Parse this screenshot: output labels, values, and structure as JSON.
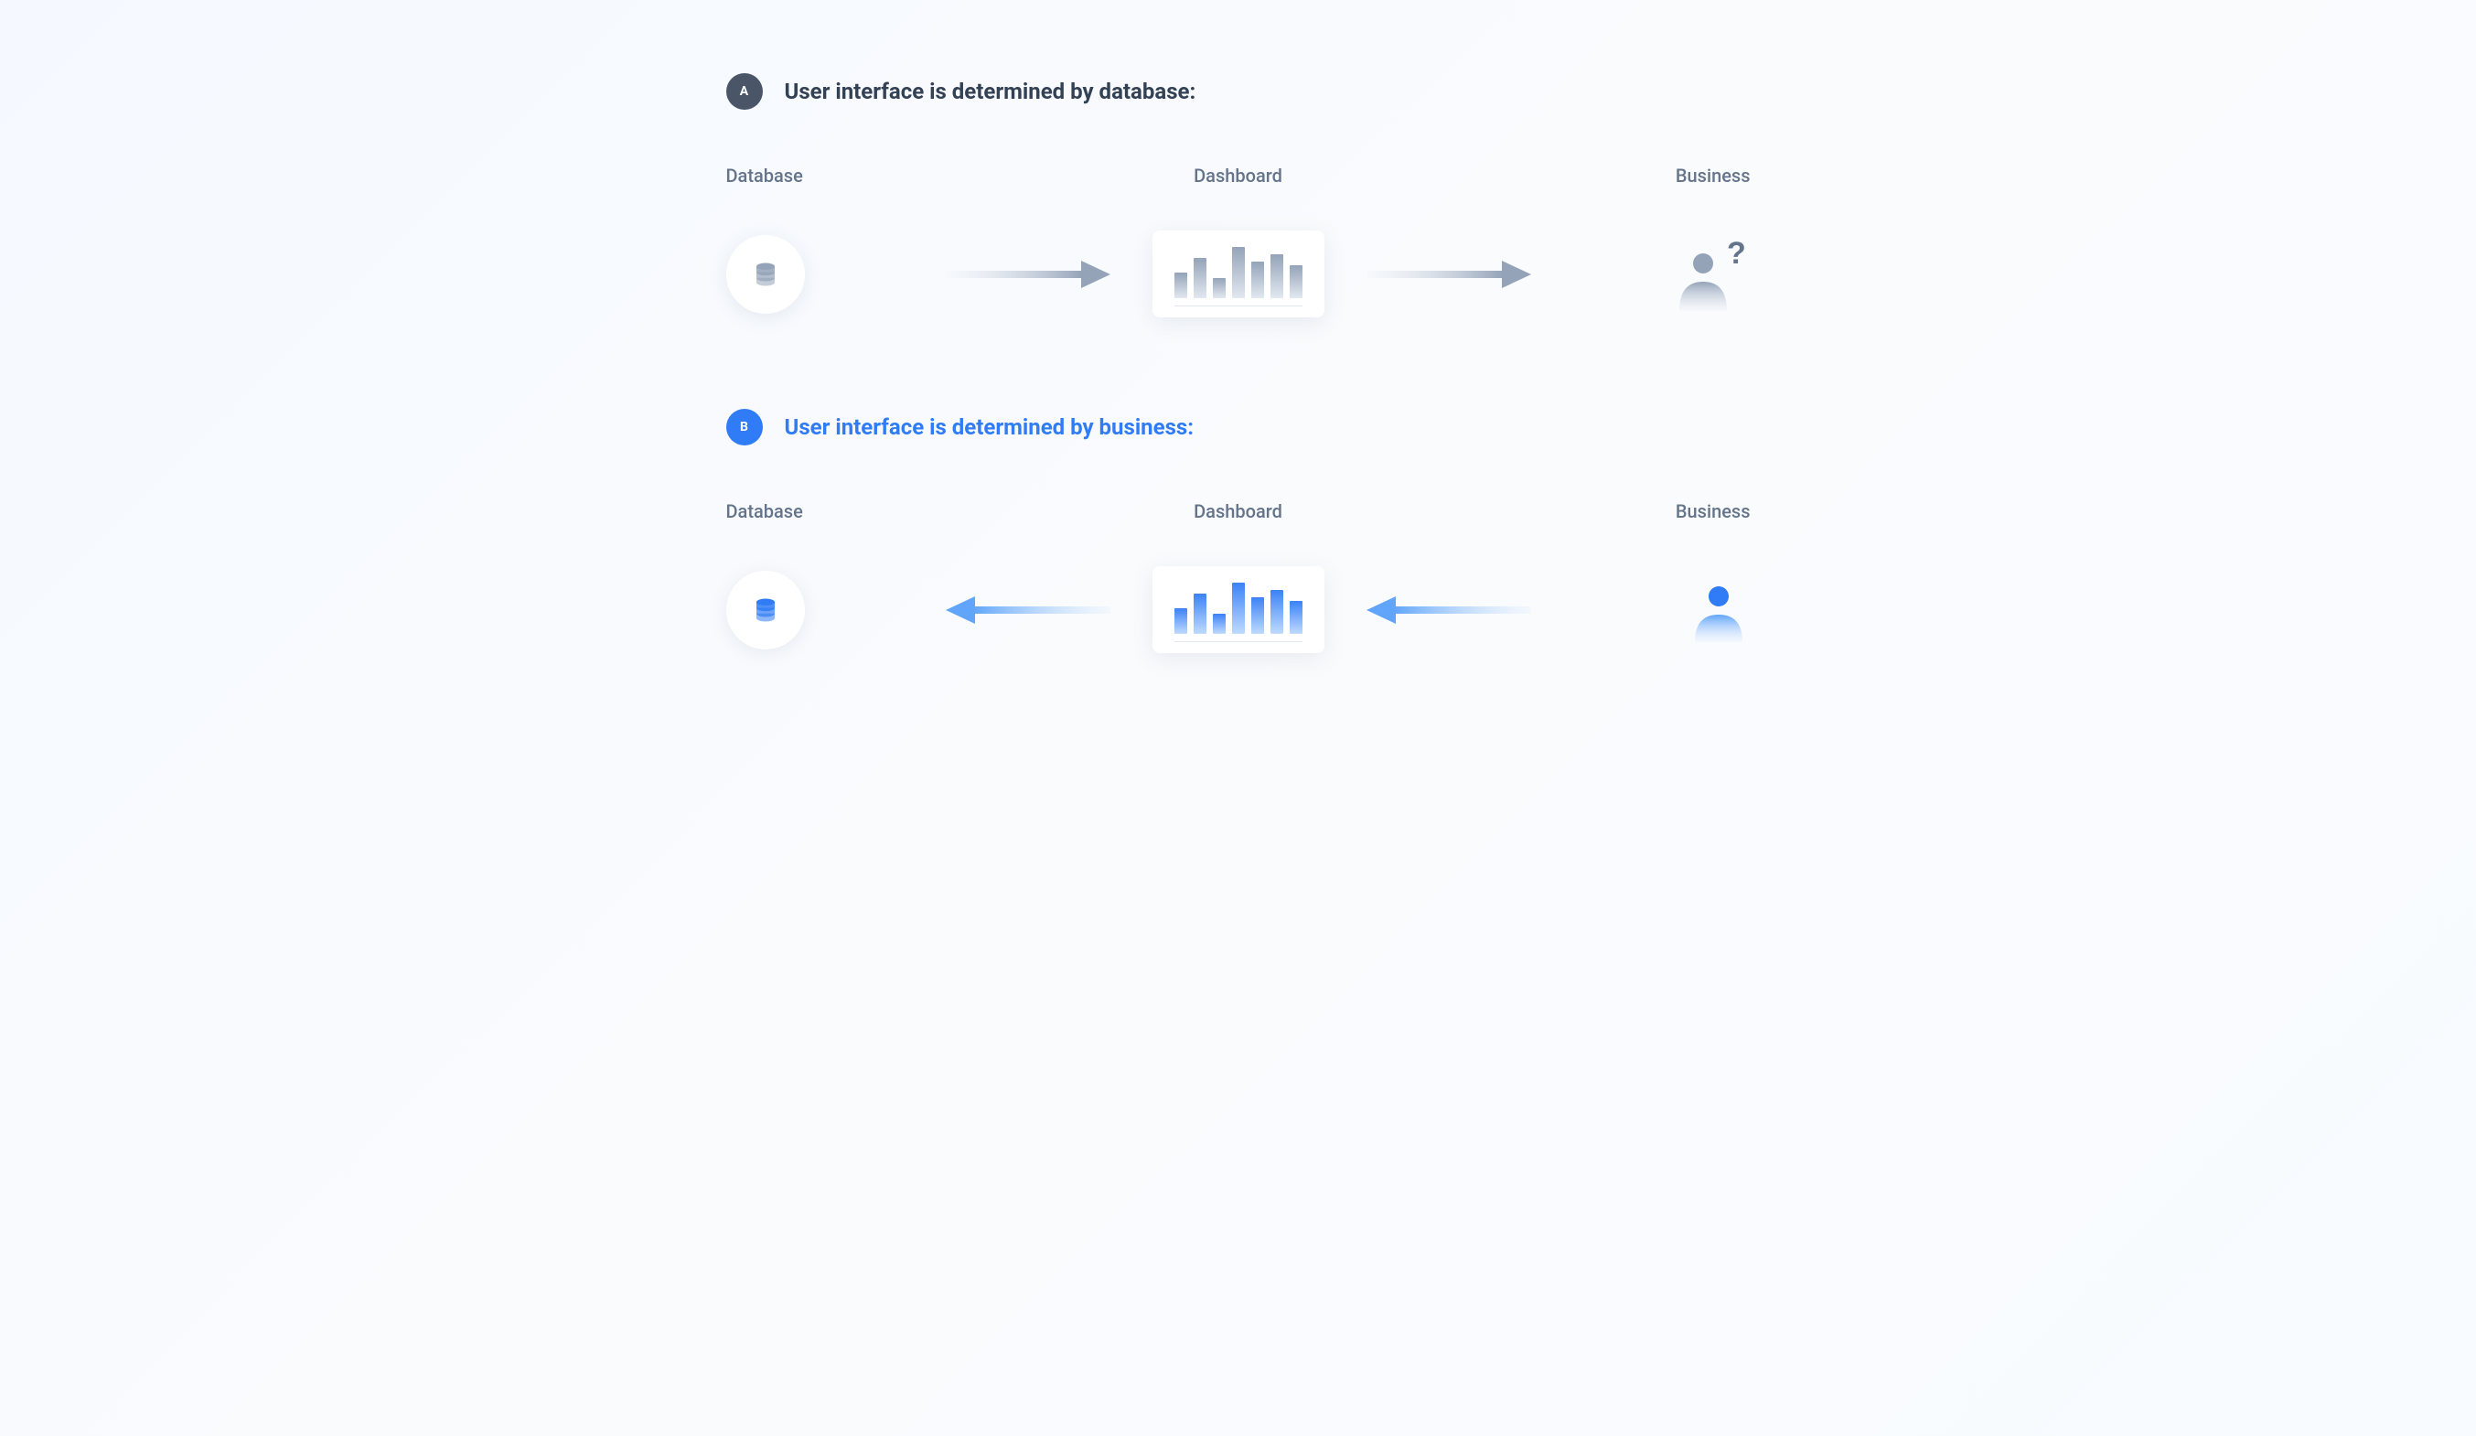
{
  "sectionA": {
    "badge": "A",
    "title": "User interface is determined by database:",
    "labels": {
      "left": "Database",
      "center": "Dashboard",
      "right": "Business"
    }
  },
  "sectionB": {
    "badge": "B",
    "title": "User interface is determined by business:",
    "labels": {
      "left": "Database",
      "center": "Dashboard",
      "right": "Business"
    }
  },
  "colors": {
    "gray": "#94a3b8",
    "blue": "#2f7cf6",
    "textMuted": "#64748b"
  },
  "barHeights": [
    28,
    44,
    22,
    56,
    40,
    48,
    36
  ]
}
